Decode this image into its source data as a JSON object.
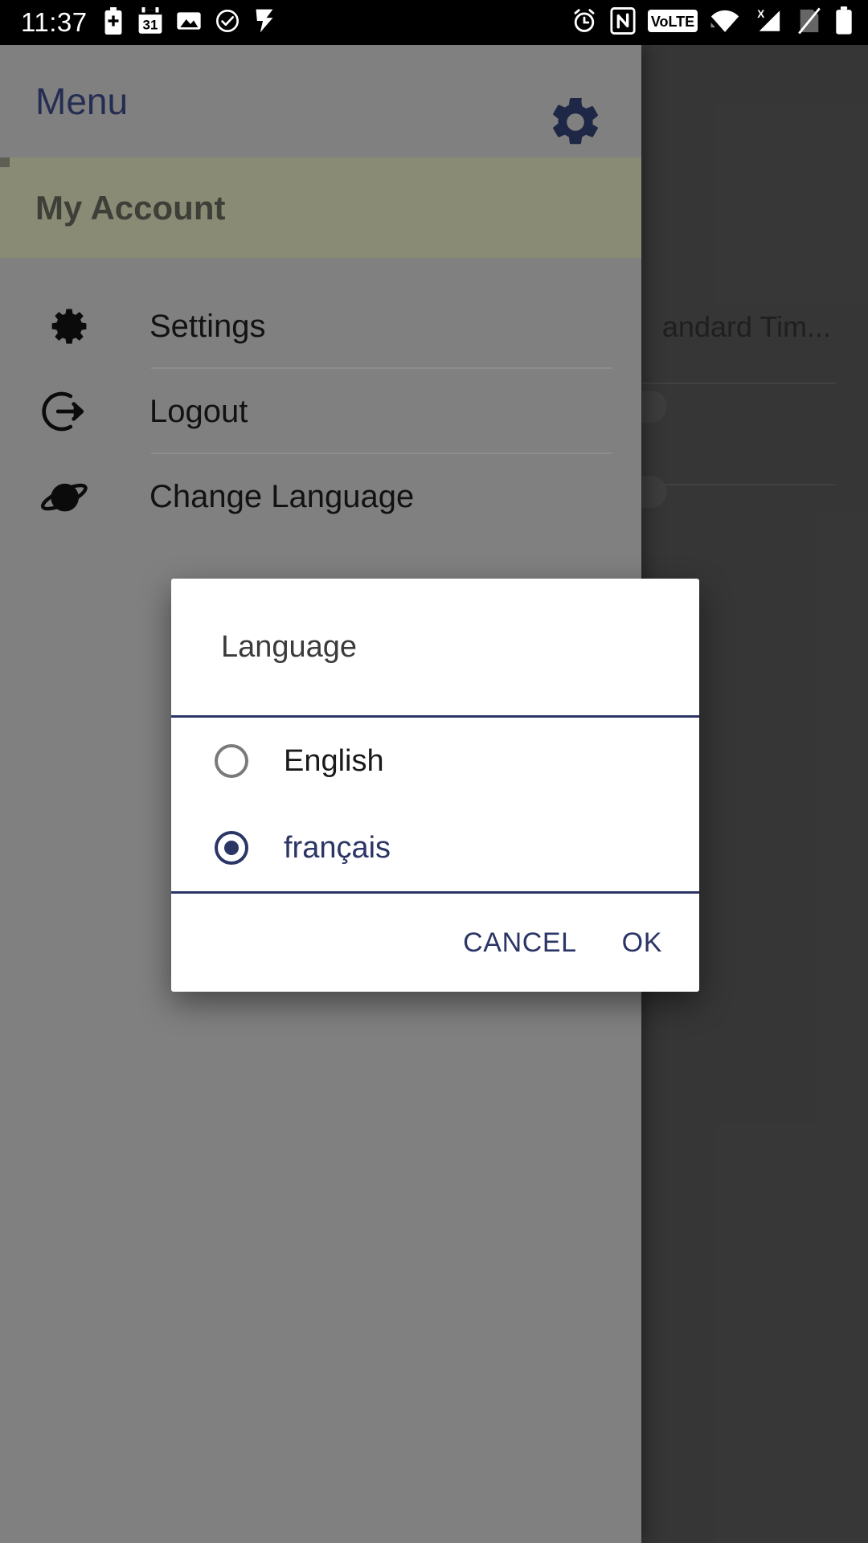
{
  "status_bar": {
    "time": "11:37",
    "left_icons": [
      {
        "name": "battery-plus-icon"
      },
      {
        "name": "calendar-icon",
        "label": "31"
      },
      {
        "name": "image-icon"
      },
      {
        "name": "check-circle-icon"
      },
      {
        "name": "flag-check-icon"
      }
    ],
    "right_icons": [
      {
        "name": "alarm-clock-icon"
      },
      {
        "name": "nfc-icon"
      },
      {
        "name": "volte-icon",
        "label": "VoLTE"
      },
      {
        "name": "wifi-icon"
      },
      {
        "name": "signal-no-service-icon",
        "label": "X"
      },
      {
        "name": "sim-disabled-icon"
      },
      {
        "name": "battery-icon"
      }
    ]
  },
  "drawer": {
    "title": "Menu",
    "settings_gear_icon": "gear-icon",
    "account_label": "My Account",
    "items": [
      {
        "label": "Settings",
        "icon": "cog-icon"
      },
      {
        "label": "Logout",
        "icon": "logout-arrow-icon"
      },
      {
        "label": "Change Language",
        "icon": "planet-icon"
      }
    ]
  },
  "app_background": {
    "truncated_title": "andard Tim...",
    "toggles": [
      {
        "state": "off"
      },
      {
        "state": "off"
      }
    ]
  },
  "dialog": {
    "title": "Language",
    "options": [
      {
        "label": "English",
        "selected": false
      },
      {
        "label": "français",
        "selected": true
      }
    ],
    "cancel_label": "CANCEL",
    "ok_label": "OK"
  },
  "colors": {
    "accent_navy": "#2b3566",
    "drawer_bg": "#808080",
    "account_band": "#8a8b75",
    "app_bg": "#4c4c4c",
    "dialog_bg": "#ffffff",
    "radio_unselected": "#7a7a7a"
  }
}
